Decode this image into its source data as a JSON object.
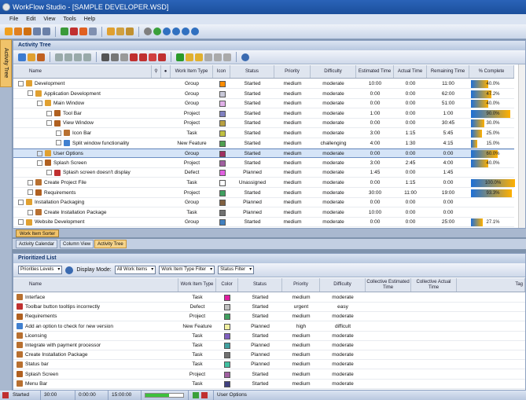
{
  "window": {
    "title": "WorkFlow Studio - [SAMPLE DEVELOPER.WSD]"
  },
  "menu": [
    "File",
    "Edit",
    "View",
    "Tools",
    "Help"
  ],
  "sidetab": "Activity Tree",
  "tree_panel": {
    "title": "Activity Tree",
    "columns": [
      "Name",
      "Work Item Type",
      "Icon",
      "Status",
      "Priority",
      "Difficulty",
      "Estimated Time",
      "Actual Time",
      "Remaining Time",
      "% Complete"
    ],
    "rows": [
      {
        "indent": 0,
        "name": "Development",
        "type": "Group",
        "color": "#ff8c00",
        "status": "Started",
        "priority": "medium",
        "difficulty": "moderate",
        "est": "10:00",
        "act": "0:00",
        "rem": "11:00",
        "pct": "40.0%",
        "fill": 0.4,
        "icon": "group"
      },
      {
        "indent": 1,
        "name": "Application Development",
        "type": "Group",
        "color": "#c8c8d8",
        "status": "Started",
        "priority": "medium",
        "difficulty": "moderate",
        "est": "0:00",
        "act": "0:00",
        "rem": "62:00",
        "pct": "47.2%",
        "fill": 0.47,
        "icon": "group"
      },
      {
        "indent": 2,
        "name": "Main Window",
        "type": "Group",
        "color": "#e0b0e8",
        "status": "Started",
        "priority": "medium",
        "difficulty": "moderate",
        "est": "0:00",
        "act": "0:00",
        "rem": "51:00",
        "pct": "40.0%",
        "fill": 0.4,
        "icon": "group"
      },
      {
        "indent": 3,
        "name": "Tool Bar",
        "type": "Project",
        "color": "#8080c0",
        "status": "Started",
        "priority": "medium",
        "difficulty": "moderate",
        "est": "1:00",
        "act": "0:00",
        "rem": "1:00",
        "pct": "90.0%",
        "fill": 0.9,
        "icon": "project"
      },
      {
        "indent": 3,
        "name": "View Window",
        "type": "Project",
        "color": "#b8a040",
        "status": "Started",
        "priority": "medium",
        "difficulty": "moderate",
        "est": "0:00",
        "act": "0:00",
        "rem": "30:45",
        "pct": "30.0%",
        "fill": 0.3,
        "icon": "project"
      },
      {
        "indent": 4,
        "name": "Icon Bar",
        "type": "Task",
        "color": "#c0c040",
        "status": "Started",
        "priority": "medium",
        "difficulty": "moderate",
        "est": "3:00",
        "act": "1:15",
        "rem": "5:45",
        "pct": "25.0%",
        "fill": 0.25,
        "icon": "task"
      },
      {
        "indent": 4,
        "name": "Split window functionality",
        "type": "New Feature",
        "color": "#50a050",
        "status": "Started",
        "priority": "medium",
        "difficulty": "challenging",
        "est": "4:00",
        "act": "1:30",
        "rem": "4:15",
        "pct": "15.0%",
        "fill": 0.15,
        "icon": "feature"
      },
      {
        "indent": 2,
        "name": "User Options",
        "type": "Group",
        "color": "#a03060",
        "status": "Started",
        "priority": "medium",
        "difficulty": "moderate",
        "est": "0:00",
        "act": "0:00",
        "rem": "0:00",
        "pct": "60.0%",
        "fill": 0.6,
        "icon": "group",
        "selected": true
      },
      {
        "indent": 2,
        "name": "Splash Screen",
        "type": "Project",
        "color": "#a060a0",
        "status": "Started",
        "priority": "medium",
        "difficulty": "moderate",
        "est": "3:00",
        "act": "2:45",
        "rem": "4:00",
        "pct": "40.0%",
        "fill": 0.4,
        "icon": "project"
      },
      {
        "indent": 3,
        "name": "Splash screen doesn't display",
        "type": "Defect",
        "color": "#e060e0",
        "status": "Planned",
        "priority": "medium",
        "difficulty": "moderate",
        "est": "1:45",
        "act": "0:00",
        "rem": "1:45",
        "pct": "",
        "fill": 0,
        "icon": "defect"
      },
      {
        "indent": 1,
        "name": "Create Project File",
        "type": "Task",
        "color": "#ffffff",
        "status": "Unassigned",
        "priority": "medium",
        "difficulty": "moderate",
        "est": "0:00",
        "act": "1:15",
        "rem": "0:00",
        "pct": "100.0%",
        "fill": 1.0,
        "icon": "task"
      },
      {
        "indent": 1,
        "name": "Requirements",
        "type": "Project",
        "color": "#40a060",
        "status": "Started",
        "priority": "medium",
        "difficulty": "moderate",
        "est": "30:00",
        "act": "11:00",
        "rem": "19:00",
        "pct": "93.3%",
        "fill": 0.93,
        "icon": "project"
      },
      {
        "indent": 0,
        "name": "Installation Packaging",
        "type": "Group",
        "color": "#806040",
        "status": "Planned",
        "priority": "medium",
        "difficulty": "moderate",
        "est": "0:00",
        "act": "0:00",
        "rem": "0:00",
        "pct": "",
        "fill": 0,
        "icon": "group"
      },
      {
        "indent": 1,
        "name": "Create Installation Package",
        "type": "Task",
        "color": "#707070",
        "status": "Planned",
        "priority": "medium",
        "difficulty": "moderate",
        "est": "10:00",
        "act": "0:00",
        "rem": "0:00",
        "pct": "",
        "fill": 0,
        "icon": "task"
      },
      {
        "indent": 0,
        "name": "Website Development",
        "type": "Group",
        "color": "#4080c0",
        "status": "Started",
        "priority": "medium",
        "difficulty": "moderate",
        "est": "0:00",
        "act": "0:00",
        "rem": "25:00",
        "pct": "27.1%",
        "fill": 0.27,
        "icon": "group"
      }
    ]
  },
  "bottom_tab": "Work Item Sorter",
  "view_tabs": [
    "Activity Calendar",
    "Column View",
    "Activity Tree"
  ],
  "list_panel": {
    "title": "Prioritized List",
    "combo1": "Priorities Levels",
    "display_mode_label": "Display Mode:",
    "combo2": "All Work Items",
    "combo3": "Work Item Type Filter",
    "combo4": "Status Filter",
    "columns": [
      "Name",
      "Work Item Type",
      "Color",
      "Status",
      "Priority",
      "Difficulty",
      "Collective Estimated Time",
      "Collective Actual Time",
      "Tag"
    ],
    "rows": [
      {
        "name": "Interface",
        "type": "Task",
        "color": "#e020a0",
        "status": "Started",
        "priority": "medium",
        "difficulty": "moderate",
        "icon": "task"
      },
      {
        "name": "Toolbar button tooltips incorrectly",
        "type": "Defect",
        "color": "#c0c0c0",
        "status": "Started",
        "priority": "urgent",
        "difficulty": "easy",
        "icon": "defect"
      },
      {
        "name": "Requirements",
        "type": "Project",
        "color": "#40a060",
        "status": "Started",
        "priority": "medium",
        "difficulty": "moderate",
        "icon": "project"
      },
      {
        "name": "Add an option to check for new version",
        "type": "New Feature",
        "color": "#f0f0a0",
        "status": "Planned",
        "priority": "high",
        "difficulty": "difficult",
        "icon": "feature"
      },
      {
        "name": "Licensing",
        "type": "Task",
        "color": "#8060c0",
        "status": "Started",
        "priority": "medium",
        "difficulty": "moderate",
        "icon": "task"
      },
      {
        "name": "Integrate with payment processor",
        "type": "Task",
        "color": "#40a0a0",
        "status": "Planned",
        "priority": "medium",
        "difficulty": "moderate",
        "icon": "task"
      },
      {
        "name": "Create Installation Package",
        "type": "Task",
        "color": "#707070",
        "status": "Planned",
        "priority": "medium",
        "difficulty": "moderate",
        "icon": "task"
      },
      {
        "name": "Status bar",
        "type": "Task",
        "color": "#40c0a0",
        "status": "Planned",
        "priority": "medium",
        "difficulty": "moderate",
        "icon": "task"
      },
      {
        "name": "Splash Screen",
        "type": "Project",
        "color": "#a060a0",
        "status": "Started",
        "priority": "medium",
        "difficulty": "moderate",
        "icon": "project"
      },
      {
        "name": "Menu Bar",
        "type": "Task",
        "color": "#404080",
        "status": "Started",
        "priority": "medium",
        "difficulty": "moderate",
        "icon": "task"
      }
    ]
  },
  "status": {
    "item1": "Started",
    "item2": "30:00",
    "item3": "0:00:00",
    "item4": "15:00:00",
    "item5": "User Options"
  }
}
